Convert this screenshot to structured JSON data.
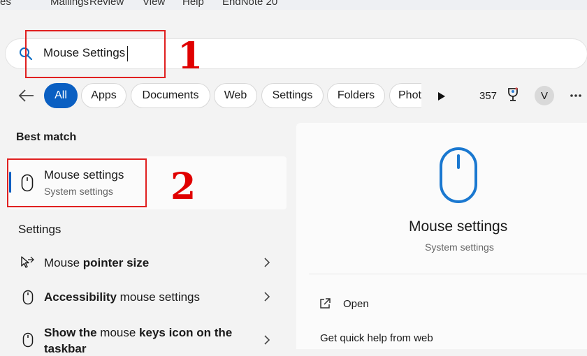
{
  "ribbon": {
    "items": [
      "es",
      "Mailings",
      "Review",
      "View",
      "Help",
      "EndNote 20"
    ]
  },
  "search": {
    "value": "Mouse Settings"
  },
  "annotations": {
    "step1": "1",
    "step2": "2"
  },
  "filters": {
    "chips": [
      {
        "label": "All",
        "active": true
      },
      {
        "label": "Apps",
        "active": false
      },
      {
        "label": "Documents",
        "active": false
      },
      {
        "label": "Web",
        "active": false
      },
      {
        "label": "Settings",
        "active": false
      },
      {
        "label": "Folders",
        "active": false
      },
      {
        "label": "Phot",
        "active": false
      }
    ],
    "points": "357",
    "avatar_initial": "V"
  },
  "best_match": {
    "heading": "Best match",
    "title": "Mouse settings",
    "subtitle": "System settings"
  },
  "settings": {
    "heading": "Settings",
    "items": [
      {
        "pre": "Mouse ",
        "bold": "pointer size",
        "post": "",
        "icon": "pointer-size-icon"
      },
      {
        "pre": "",
        "bold": "Accessibility",
        "post": " mouse settings",
        "icon": "mouse-icon"
      },
      {
        "pre": "",
        "bold": "Show the",
        "post": " mouse ",
        "bold2": "keys icon on the",
        "line2": "taskbar",
        "icon": "mouse-icon"
      }
    ]
  },
  "preview": {
    "title": "Mouse settings",
    "subtitle": "System settings",
    "actions": [
      "Open",
      "Get quick help from web"
    ]
  },
  "colors": {
    "accent": "#0a5fc2",
    "annotation": "#e00000"
  }
}
